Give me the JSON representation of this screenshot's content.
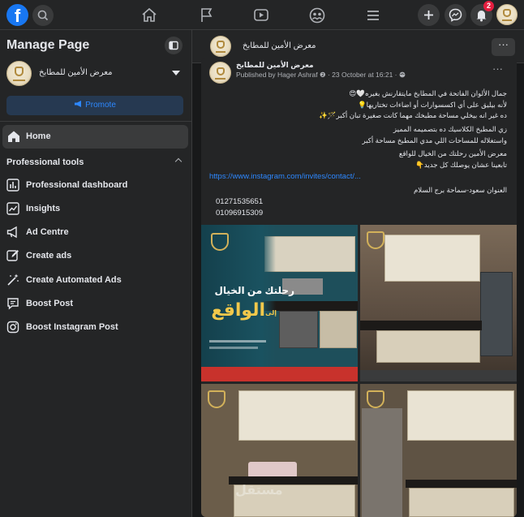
{
  "topbar": {
    "logo": "f",
    "notification_count": "2",
    "icons": [
      "facebook-logo",
      "search-icon",
      "home-icon",
      "flag-icon",
      "video-icon",
      "groups-icon",
      "menu-icon",
      "plus-icon",
      "messenger-icon",
      "bell-icon"
    ]
  },
  "sidebar": {
    "title": "Manage Page",
    "page_name": "معرض الأمين للمطابخ",
    "promote_label": "Promote",
    "home_label": "Home",
    "section_label": "Professional tools",
    "tools": [
      {
        "label": "Professional dashboard",
        "icon": "dashboard-icon"
      },
      {
        "label": "Insights",
        "icon": "insights-icon"
      },
      {
        "label": "Ad Centre",
        "icon": "megaphone-icon"
      },
      {
        "label": "Create ads",
        "icon": "edit-icon"
      },
      {
        "label": "Create Automated Ads",
        "icon": "magic-wand-icon"
      },
      {
        "label": "Boost Post",
        "icon": "chat-bubble-icon"
      },
      {
        "label": "Boost Instagram Post",
        "icon": "instagram-icon"
      }
    ]
  },
  "page_header": {
    "name": "معرض الأمين للمطابخ",
    "more_label": "···"
  },
  "post": {
    "author": "معرض الأمين للمطابخ",
    "meta": "Published by Hager Ashraf ❷ · 23 October at 16:21 · ",
    "more_label": "···",
    "lines": [
      "جمال الألوان الفاتحة في المطابخ مايتقارنش بغيره🤍😍",
      "لأنه بيليق على أي اكسسوارات أو اضاءات تختاريها💡",
      "ده غير انه بيخلي مساحة مطبخك مهما كانت صغيرة تبان أكبر🪄✨",
      "زي المطبخ الكلاسيك ده بتصميمه المميز",
      "واستغلاله للمساحات اللي مدي المطبخ مساحة أكبر",
      "معرض الأمين رحلتك من الخيال للواقع",
      "تابعينا عشان يوصلك كل جديد👇",
      "العنوان سعود-سماحة برج السلام"
    ],
    "link": "https://www.instagram.com/invites/contact/...",
    "phones": [
      "01271535651",
      "01096915309"
    ],
    "promo": {
      "line1": "رحلتك من الخيال",
      "line2": "الواقع",
      "line2_prefix": "إلى"
    },
    "watermark": "مستقل"
  },
  "colors": {
    "background": "#18191a",
    "surface": "#242526",
    "hover": "#3a3b3c",
    "accent": "#2d88ff",
    "text": "#e4e6eb",
    "secondary_text": "#b0b3b8",
    "badge": "#e41e3f"
  }
}
